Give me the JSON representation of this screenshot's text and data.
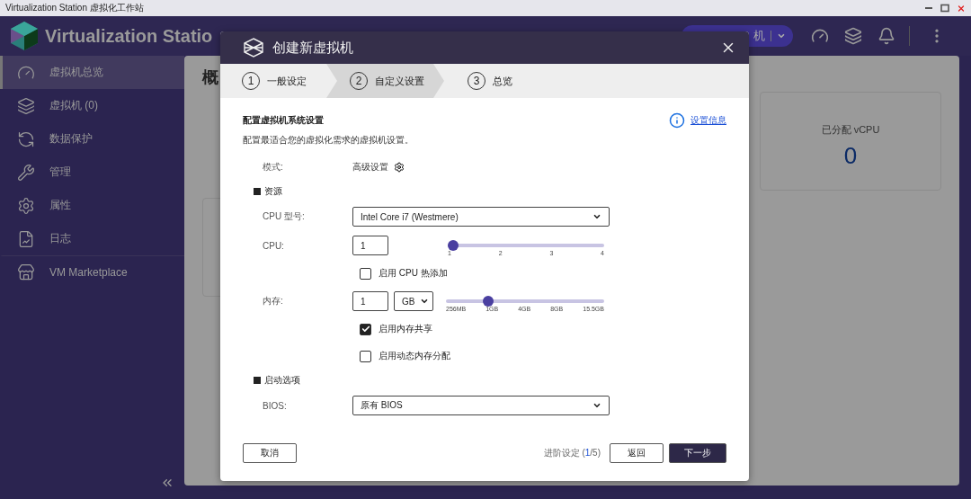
{
  "window": {
    "title": "Virtualization Station 虚拟化工作站"
  },
  "header": {
    "app_name": "Virtualization Statio",
    "create_button": "机"
  },
  "sidebar": {
    "items": [
      {
        "label": "虚拟机总览",
        "selected": true
      },
      {
        "label": "虚拟机 (0)",
        "selected": false
      },
      {
        "label": "数据保护",
        "selected": false
      },
      {
        "label": "管理",
        "selected": false
      },
      {
        "label": "属性",
        "selected": false
      },
      {
        "label": "日志",
        "selected": false
      },
      {
        "label": "VM Marketplace",
        "selected": false
      }
    ]
  },
  "main": {
    "title": "概",
    "card": {
      "label": "已分配 vCPU",
      "value": "0"
    }
  },
  "dialog": {
    "title": "创建新虚拟机",
    "steps": [
      {
        "number": "1",
        "label": "一般设定",
        "selected": false
      },
      {
        "number": "2",
        "label": "自定义设置",
        "selected": true
      },
      {
        "number": "3",
        "label": "总览",
        "selected": false
      }
    ],
    "heading": "配置虚拟机系统设置",
    "info_link": "设置信息",
    "description": "配置最适合您的虚拟化需求的虚拟机设置。",
    "mode": {
      "label": "模式:",
      "value": "高级设置"
    },
    "sections": [
      {
        "heading": "资源",
        "fields": [
          {
            "kind": "select",
            "label": "CPU 型号:",
            "value": "Intel Core i7 (Westmere)"
          },
          {
            "kind": "slider",
            "label": "CPU:",
            "value": "1",
            "level": 0,
            "ticks": [
              "1",
              "2",
              "3",
              "4"
            ]
          },
          {
            "kind": "checkbox",
            "label": "启用 CPU 热添加",
            "checked": false
          },
          {
            "kind": "slider",
            "label": "内存:",
            "value": "1",
            "unit": "GB",
            "level": 0.25,
            "ticks": [
              "256MB",
              "1GB",
              "4GB",
              "8GB",
              "15.5GB"
            ]
          },
          {
            "kind": "checkbox",
            "label": "启用内存共享",
            "checked": true
          },
          {
            "kind": "checkbox",
            "label": "启用动态内存分配",
            "checked": false
          }
        ]
      },
      {
        "heading": "启动选项",
        "fields": [
          {
            "kind": "select",
            "label": "BIOS:",
            "value": "原有 BIOS"
          }
        ]
      }
    ],
    "footer": {
      "cancel": "取消",
      "progress_prefix": "进阶设定 (",
      "progress_current": "1",
      "progress_suffix": "/5)",
      "back": "返回",
      "next": "下一步"
    }
  }
}
